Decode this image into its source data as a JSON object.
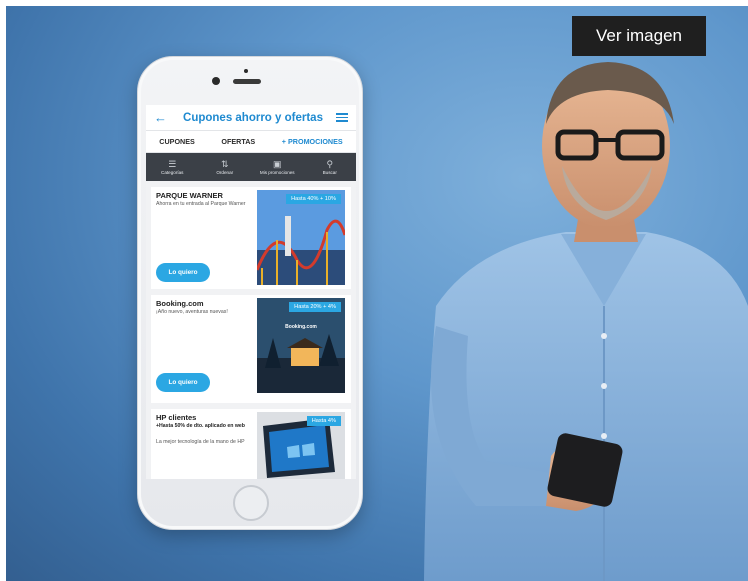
{
  "overlay": {
    "ver_imagen": "Ver imagen"
  },
  "app": {
    "title": "Cupones ahorro y ofertas",
    "tabs": [
      "CUPONES",
      "OFERTAS",
      "+ PROMOCIONES"
    ],
    "toolbar": [
      "Categorías",
      "Ordenar",
      "Mis promociones",
      "Buscar"
    ]
  },
  "cards": [
    {
      "title": "PARQUE WARNER",
      "desc": "Ahorra en tu entrada al Parque Warner",
      "badge": "Hasta 40% + 10%",
      "button": "Lo quiero"
    },
    {
      "title": "Booking.com",
      "desc": "¡Año nuevo, aventuras nuevas!",
      "badge": "Hasta 20% + 4%",
      "img_text": "Booking.com",
      "button": "Lo quiero"
    },
    {
      "title": "HP clientes",
      "desc_bold": "+Hasta 50% de dto. aplicado en web",
      "desc": "La mejor tecnología de la mano de HP",
      "badge": "Hasta 4%"
    }
  ],
  "colors": {
    "brand": "#1f8ad0",
    "button": "#2ba7e3",
    "toolbar": "#3b4047"
  }
}
